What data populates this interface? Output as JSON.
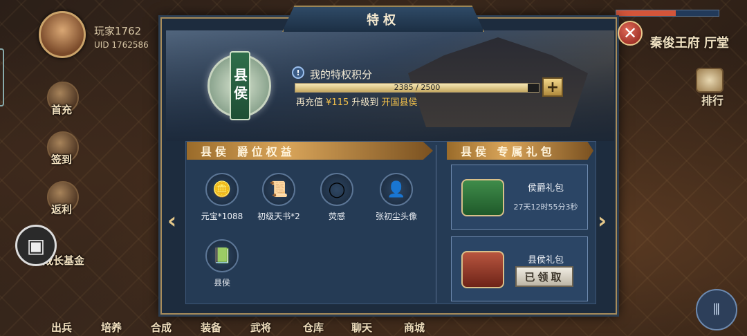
{
  "hud": {
    "player_name": "玩家1762",
    "uid": "UID 1762586",
    "location": "秦俊王府  厅堂",
    "rank_label": "排行",
    "rank_icon": "特"
  },
  "side_menu": [
    {
      "label": "首充"
    },
    {
      "label": "签到"
    },
    {
      "label": "返利"
    },
    {
      "label": "成长基金"
    }
  ],
  "bottom_menu": [
    {
      "label": "出兵"
    },
    {
      "label": "培养"
    },
    {
      "label": "合成"
    },
    {
      "label": "装备"
    },
    {
      "label": "武将"
    },
    {
      "label": "仓库"
    },
    {
      "label": "聊天"
    },
    {
      "label": "商城"
    }
  ],
  "dialog": {
    "title": "特权",
    "badge_text": "县侯",
    "points_title": "我的特权积分",
    "points_current": 2385,
    "points_max": 2500,
    "points_text": "2385 / 2500",
    "recharge_prefix": "再充值",
    "recharge_amount": "¥115",
    "upgrade_text": "升级到",
    "next_rank": "开国县侯",
    "benefits_header": "县侯 爵位权益",
    "gifts_header": "县侯 专属礼包",
    "rewards": [
      {
        "label": "元宝*1088",
        "icon": "gold-ingot-icon"
      },
      {
        "label": "初级天书*2",
        "icon": "scroll-icon"
      },
      {
        "label": "荧感",
        "icon": "ring-icon"
      },
      {
        "label": "张初尘头像",
        "icon": "portrait-icon"
      },
      {
        "label": "县侯",
        "icon": "book-icon"
      }
    ],
    "packs": [
      {
        "name": "侯爵礼包",
        "timer": "27天12时55分3秒"
      },
      {
        "name": "县侯礼包",
        "claimed": "已领取"
      }
    ]
  }
}
